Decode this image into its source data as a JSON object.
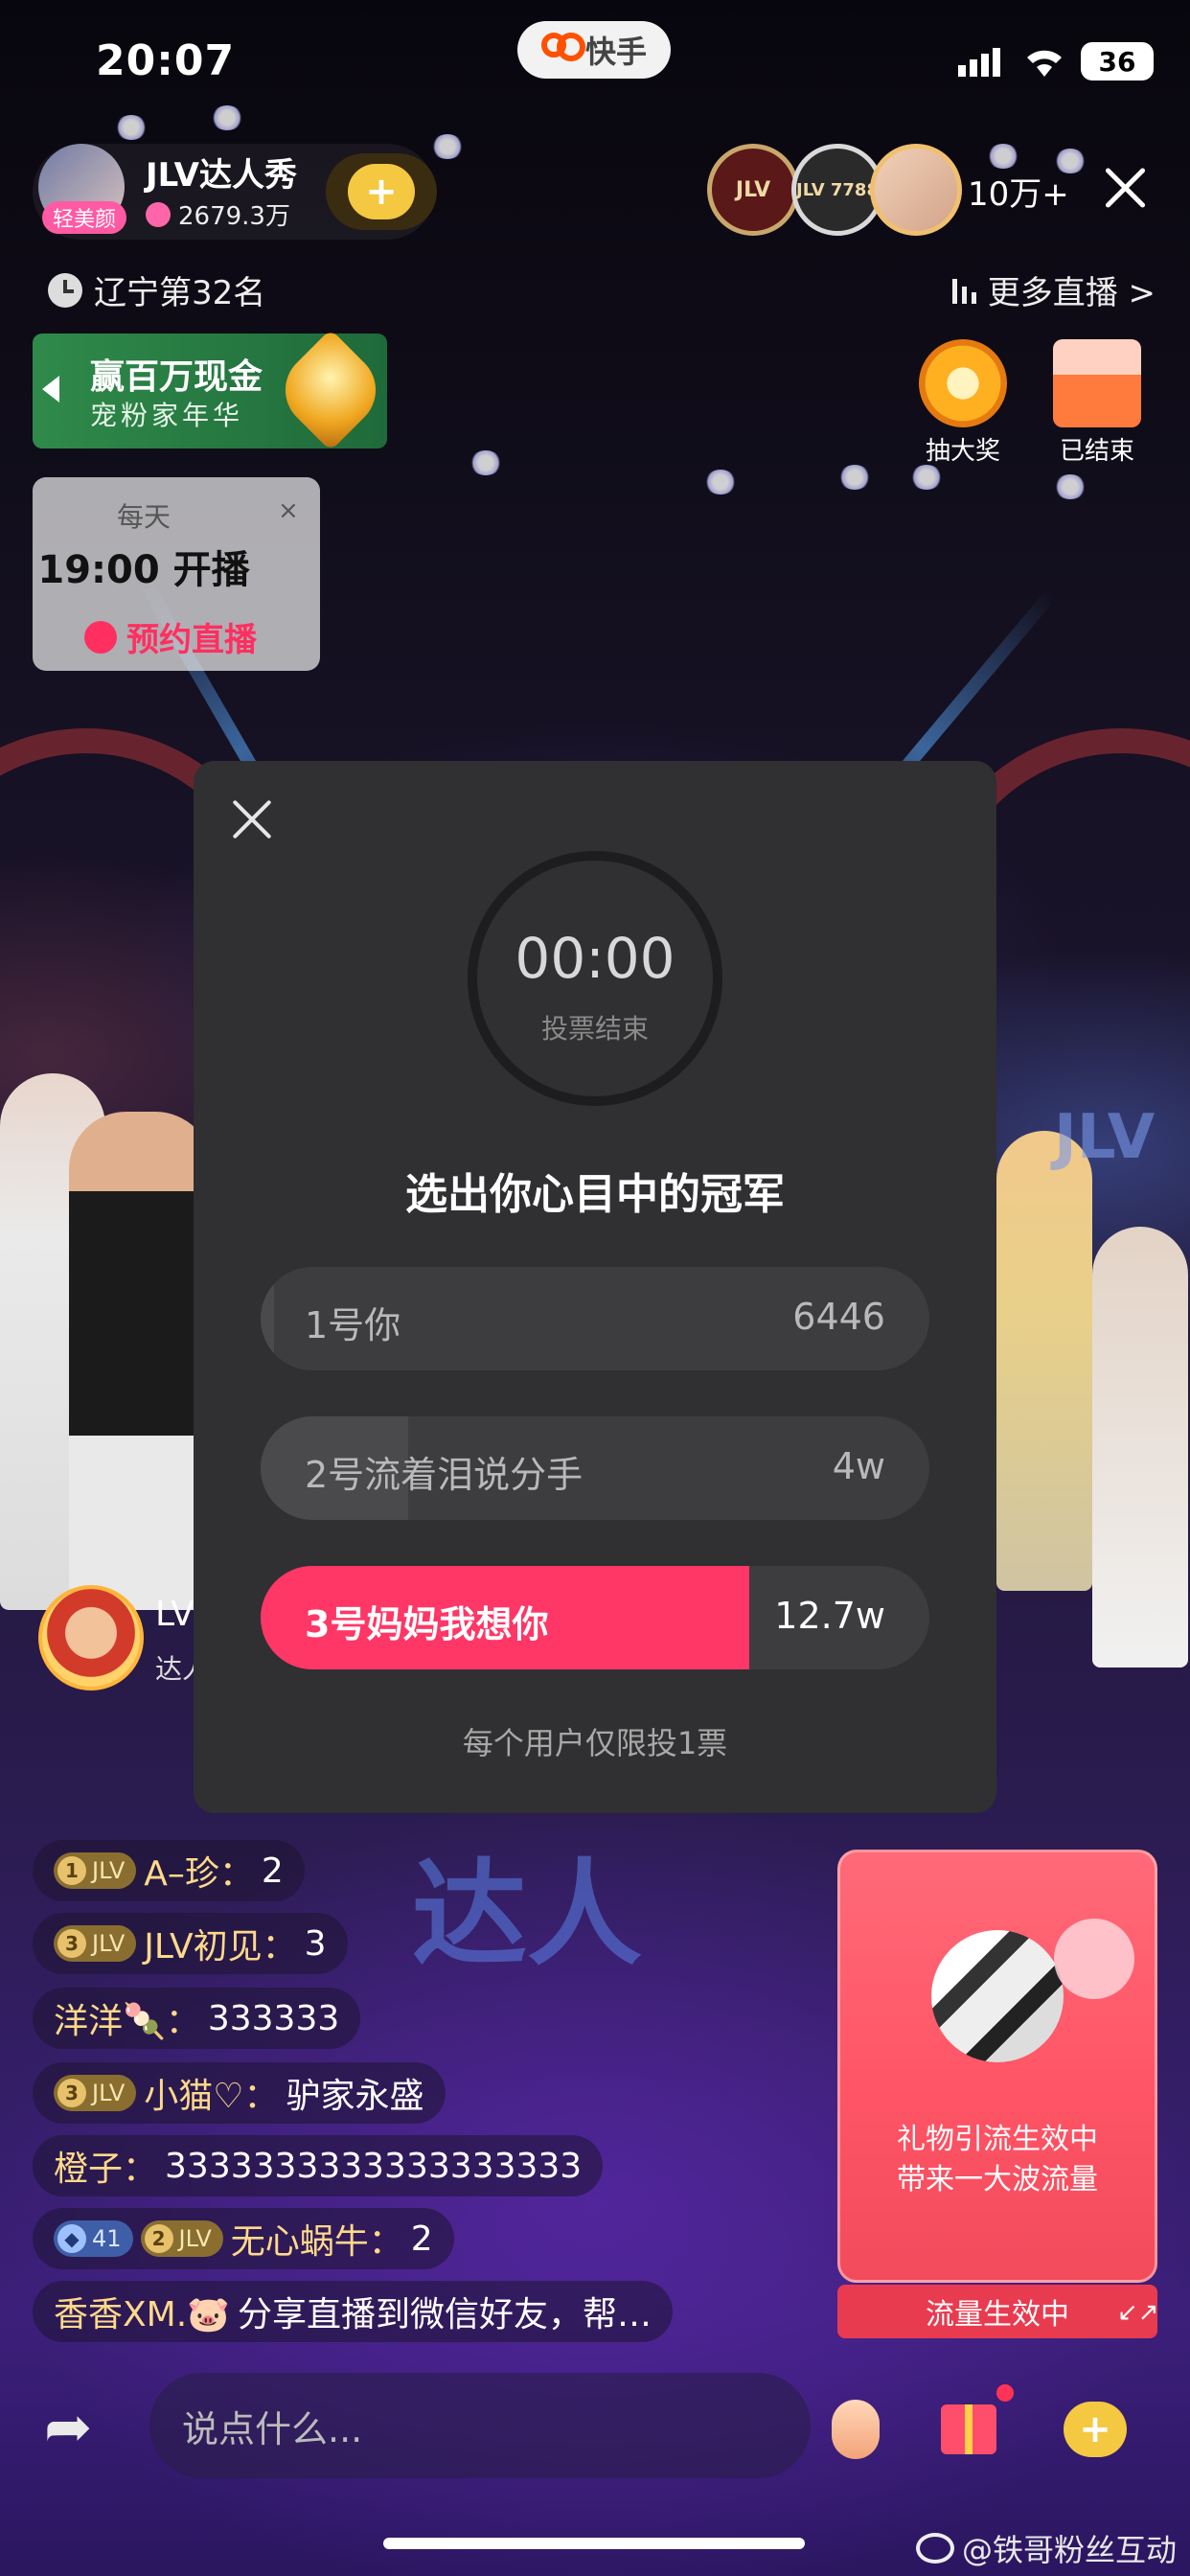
{
  "status_bar": {
    "time": "20:07",
    "app_name": "快手",
    "battery": "36"
  },
  "host": {
    "name": "JLV达人秀",
    "fans": "2679.3万",
    "avatar_tag": "轻美颜",
    "follow_icon": "+"
  },
  "viewers": {
    "badges": [
      "JLV",
      "JLV 7788"
    ],
    "count": "10万+"
  },
  "rank": {
    "text": "辽宁第32名"
  },
  "more_live": {
    "label": "更多直播 >"
  },
  "promo": {
    "title": "赢百万现金",
    "subtitle": "宠粉家年华"
  },
  "schedule": {
    "daily": "每天",
    "time": "19:00 开播",
    "button": "预约直播",
    "close": "×"
  },
  "awards": [
    {
      "label": "抽大奖",
      "color": "#ffb020"
    },
    {
      "label": "已结束",
      "color": "#ff7a3d"
    }
  ],
  "vote": {
    "timer": "00:00",
    "status": "投票结束",
    "title": "选出你心目中的冠军",
    "options": [
      {
        "label": "1号你",
        "count": "6446",
        "share": 0.02,
        "winner": false
      },
      {
        "label": "2号流着泪说分手",
        "count": "4w",
        "share": 0.22,
        "winner": false
      },
      {
        "label": "3号妈妈我想你",
        "count": "12.7w",
        "share": 0.73,
        "winner": true
      }
    ],
    "note": "每个用户仅限投1票"
  },
  "guest": {
    "name": "LV",
    "sub": "达人"
  },
  "chat": [
    {
      "badges": [
        {
          "lv": "1",
          "text": "JLV",
          "type": "gold"
        }
      ],
      "name": "A–珍：",
      "text": "2"
    },
    {
      "badges": [
        {
          "lv": "3",
          "text": "JLV",
          "type": "gold"
        }
      ],
      "name": "JLV初见：",
      "text": "3"
    },
    {
      "badges": [],
      "name": "洋洋🍡：",
      "text": "333333"
    },
    {
      "badges": [
        {
          "lv": "3",
          "text": "JLV",
          "type": "gold"
        }
      ],
      "name": "小猫♡：",
      "text": "驴家永盛"
    },
    {
      "badges": [],
      "name": "橙子：",
      "text": "3333333333333333333"
    },
    {
      "badges": [
        {
          "lv": "◆",
          "text": "41",
          "type": "blue"
        },
        {
          "lv": "2",
          "text": "JLV",
          "type": "gold"
        }
      ],
      "name": "无心蜗牛：",
      "text": "2"
    },
    {
      "badges": [],
      "name": "香香XM.🐷",
      "text": "分享直播到微信好友，帮…"
    }
  ],
  "flow_card": {
    "text_line1": "礼物引流生效中",
    "text_line2": "带来一大波流量",
    "status": "流量生效中",
    "shrink_icon": "↙↗"
  },
  "bottom": {
    "share_icon": "➦",
    "comment_placeholder": "说点什么...",
    "like_icon": "+"
  },
  "watermark": "@铁哥粉丝互动"
}
